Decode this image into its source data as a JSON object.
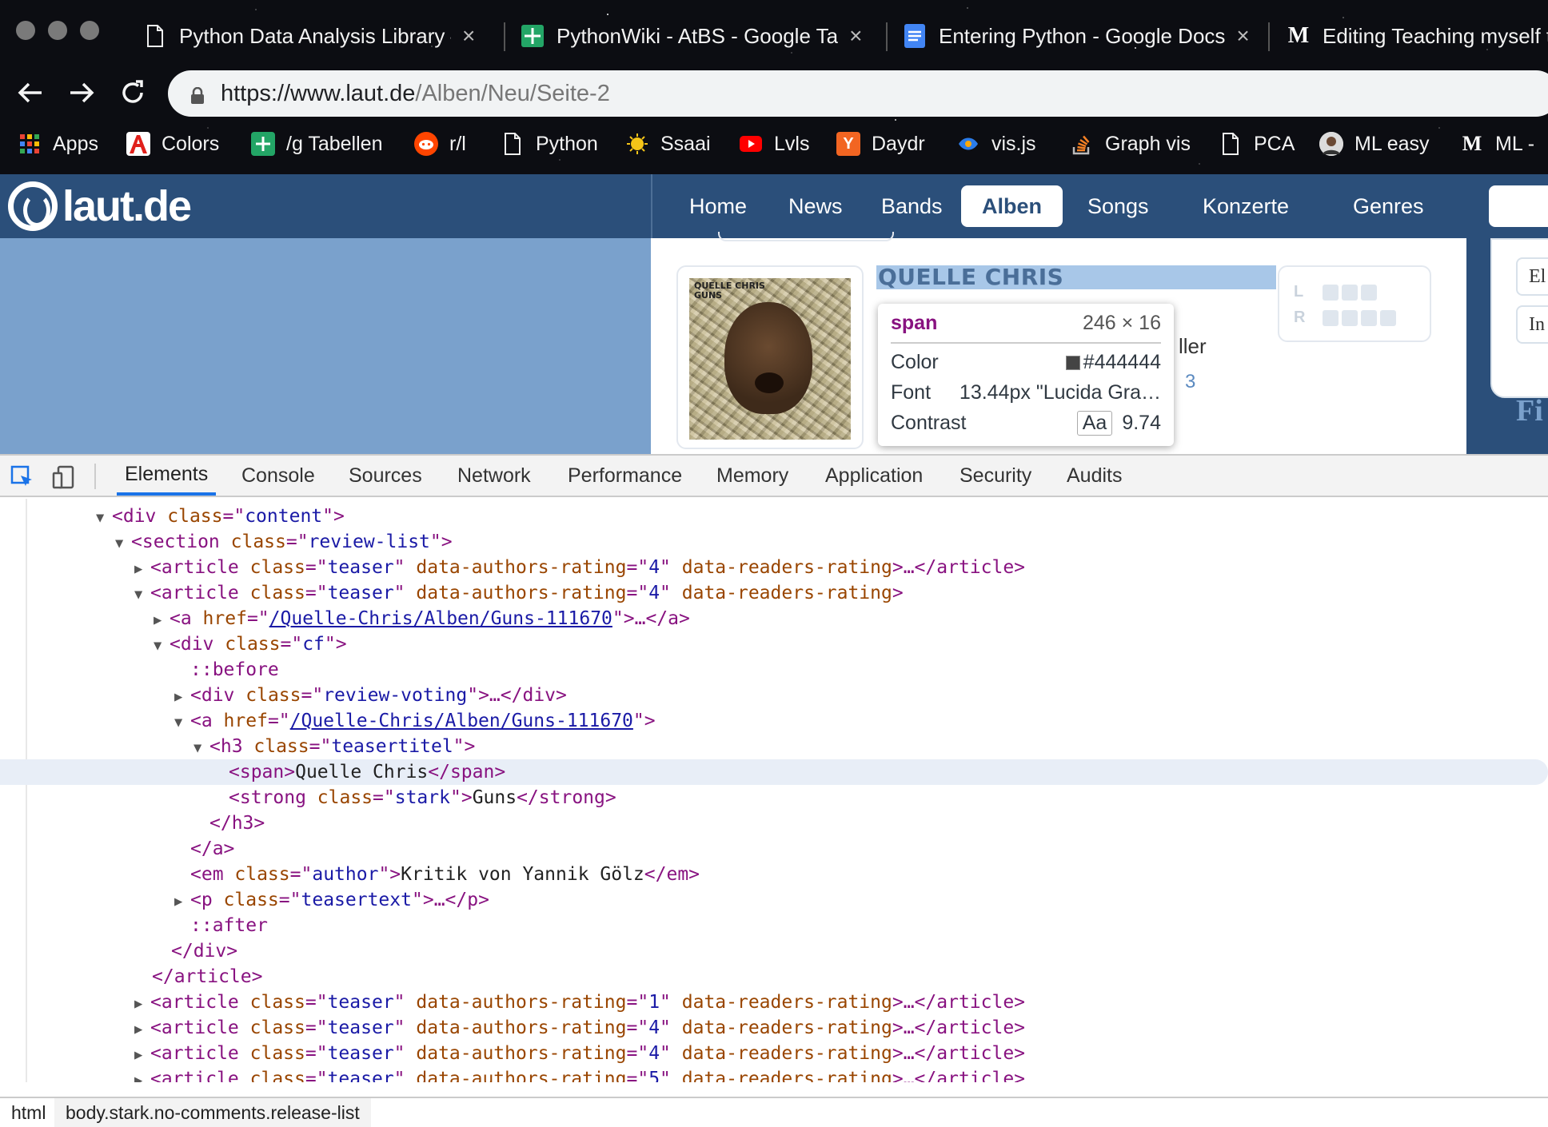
{
  "browser": {
    "tabs": [
      {
        "label": "Python Data Analysis Library –",
        "icon": "document-icon"
      },
      {
        "label": "PythonWiki - AtBS - Google Ta",
        "icon": "google-sheets-icon"
      },
      {
        "label": "Entering Python - Google Docs",
        "icon": "google-docs-icon"
      },
      {
        "label": "Editing Teaching myself t",
        "icon": "medium-icon"
      }
    ],
    "tab_close_glyph": "×",
    "url": {
      "base": "https://www.laut.de",
      "path": "/Alben/Neu/Seite-2"
    },
    "bookmarks": [
      {
        "label": "Apps",
        "icon": "apps-grid-icon"
      },
      {
        "label": "Colors",
        "icon": "adobe-icon"
      },
      {
        "label": "/g Tabellen",
        "icon": "google-sheets-icon"
      },
      {
        "label": "r/l",
        "icon": "reddit-icon"
      },
      {
        "label": "Python",
        "icon": "document-icon"
      },
      {
        "label": "Ssaai",
        "icon": "sun-icon"
      },
      {
        "label": "Lvls",
        "icon": "youtube-icon"
      },
      {
        "label": "Daydr",
        "icon": "ycombinator-icon"
      },
      {
        "label": "vis.js",
        "icon": "visjs-icon"
      },
      {
        "label": "Graph vis",
        "icon": "stackoverflow-icon"
      },
      {
        "label": "PCA",
        "icon": "document-icon"
      },
      {
        "label": "ML easy",
        "icon": "avatar-icon"
      },
      {
        "label": "ML -",
        "icon": "medium-icon"
      }
    ]
  },
  "site": {
    "logo": "laut.de",
    "nav": [
      "Home",
      "News",
      "Bands",
      "Alben",
      "Songs",
      "Konzerte",
      "Genres"
    ],
    "active_nav": "Alben",
    "teaser_title": "QUELLE CHRIS",
    "teaser_partial": "ller",
    "rating_count": "3",
    "rating_labels": [
      "L",
      "R"
    ],
    "cover_text": "QUELLE CHRIS\nGUNS",
    "side_buttons": [
      "El",
      "In"
    ],
    "side_partial": "Fi",
    "colors": {
      "header": "#2b4f7a",
      "hero": "#7aa1cc",
      "highlight": "#a8c7e8"
    }
  },
  "tooltip": {
    "tag": "span",
    "dimensions": "246 × 16",
    "color_label": "Color",
    "color_value": "#444444",
    "font_label": "Font",
    "font_value": "13.44px \"Lucida Gra…",
    "contrast_label": "Contrast",
    "contrast_aa": "Aa",
    "contrast_value": "9.74"
  },
  "devtools": {
    "tabs": [
      "Elements",
      "Console",
      "Sources",
      "Network",
      "Performance",
      "Memory",
      "Application",
      "Security",
      "Audits"
    ],
    "active_tab": "Elements",
    "breadcrumbs": [
      "html",
      "body.stark.no-comments.release-list"
    ],
    "dom": {
      "l1": {
        "tag_open": "<div ",
        "attr": "class",
        "val": "content",
        "close": ">"
      },
      "l2": {
        "tag_open": "<section ",
        "attr": "class",
        "val": "review-list",
        "close": ">"
      },
      "l3": {
        "attr2": "data-authors-rating",
        "rating": "4",
        "attr3": "data-readers-rating",
        "tail": ">…</article>"
      },
      "l4": {
        "attr2": "data-authors-rating",
        "rating": "4",
        "attr3": "data-readers-rating",
        "tail": ">"
      },
      "l5": {
        "href": "/Quelle-Chris/Alben/Guns-111670",
        "tail": ">…</a>"
      },
      "l6": {
        "val": "cf"
      },
      "l7": {
        "pseudo": "::before"
      },
      "l8": {
        "val": "review-voting",
        "tail": ">…</div>"
      },
      "l9": {
        "href": "/Quelle-Chris/Alben/Guns-111670"
      },
      "l10": {
        "val": "teasertitel"
      },
      "l11": {
        "text": "Quelle Chris"
      },
      "l12": {
        "val": "stark",
        "text": "Guns"
      },
      "l13": {
        "tag": "</h3>"
      },
      "l14": {
        "tag": "</a>"
      },
      "l15": {
        "val": "author",
        "text": "Kritik von Yannik Gölz"
      },
      "l16": {
        "val": "teasertext",
        "tail": ">…</p>"
      },
      "l17": {
        "pseudo": "::after"
      },
      "l18": {
        "tag": "</div>"
      },
      "l19": {
        "tag": "</article>"
      },
      "articles_after": [
        "1",
        "4",
        "4",
        "5"
      ]
    }
  }
}
